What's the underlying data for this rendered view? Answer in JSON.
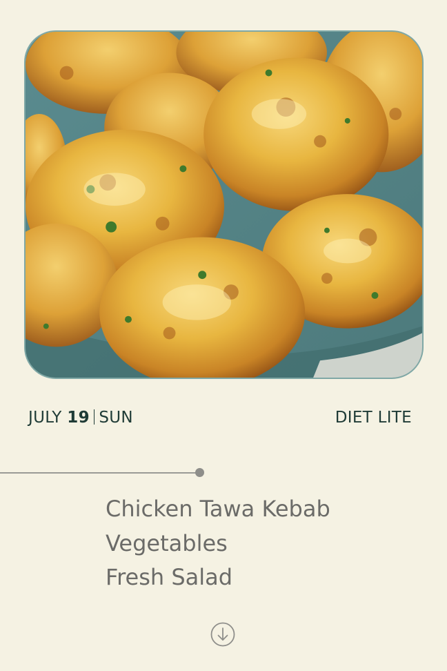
{
  "photo": {
    "icon": "food-photo",
    "subject": "chicken-tawa-kebab-patties"
  },
  "date": {
    "month": "JULY",
    "day": "19",
    "weekday": "SUN"
  },
  "plan": {
    "name": "DIET LITE"
  },
  "menu": {
    "items": [
      {
        "label": "Chicken Tawa Kebab"
      },
      {
        "label": "Vegetables"
      },
      {
        "label": "Fresh Salad"
      }
    ]
  },
  "scroll": {
    "icon": "arrow-down-circle-icon"
  },
  "colors": {
    "background": "#f5f2e3",
    "accent_dark": "#1f3b36",
    "menu_text": "#6b6b68",
    "divider": "#9a9a96",
    "plate": "#5f8f91"
  }
}
